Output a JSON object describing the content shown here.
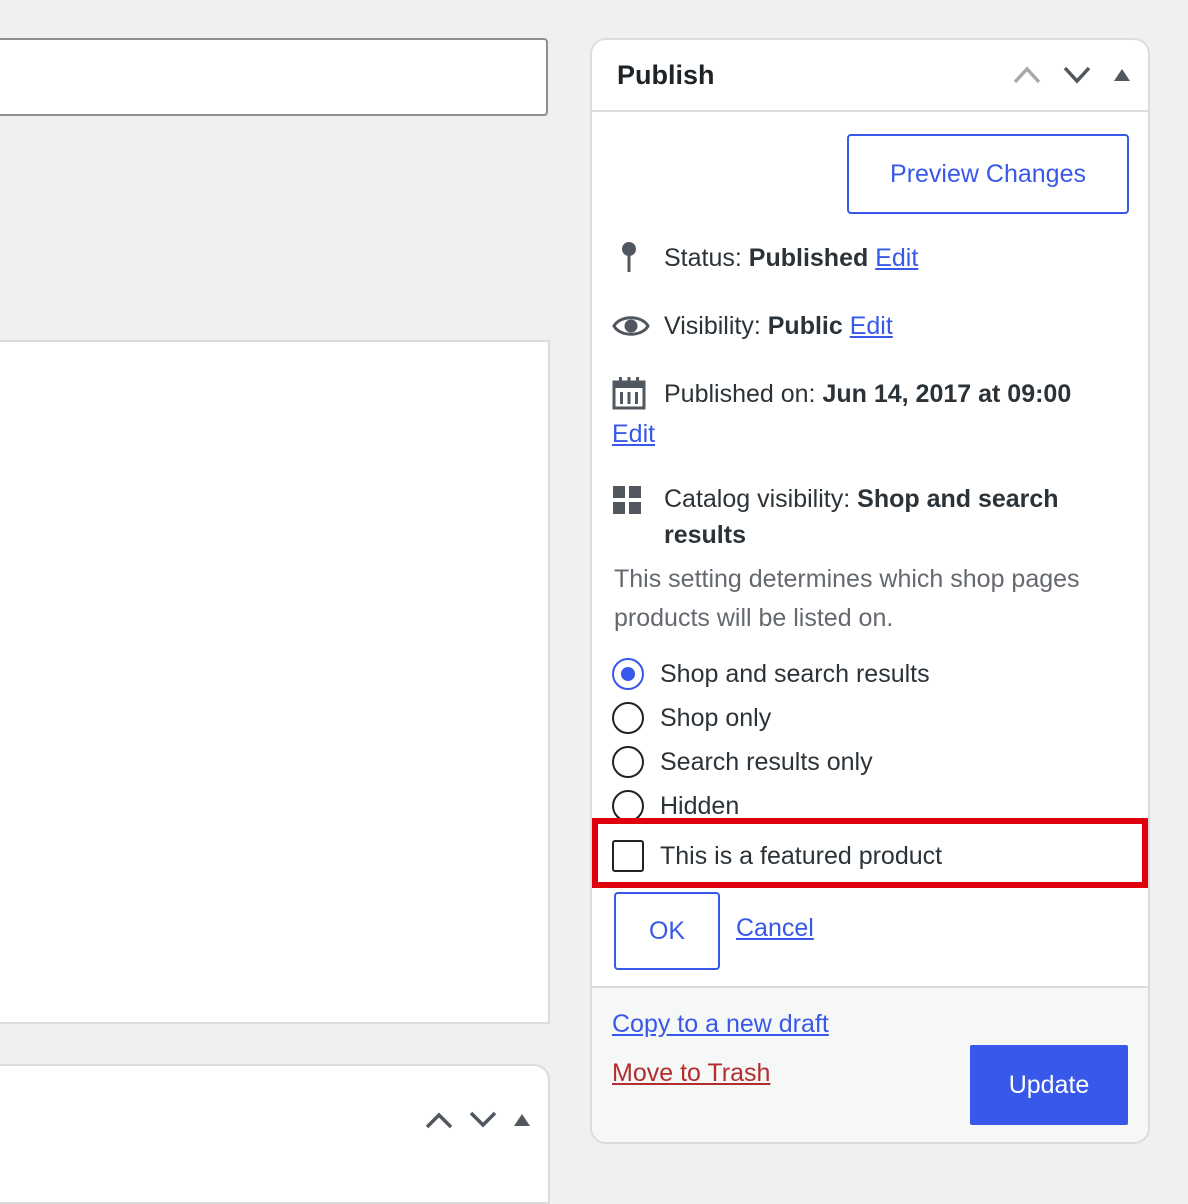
{
  "publish": {
    "title": "Publish",
    "preview_button": "Preview Changes",
    "status": {
      "label": "Status:",
      "value": "Published",
      "edit": "Edit"
    },
    "visibility": {
      "label": "Visibility:",
      "value": "Public",
      "edit": "Edit"
    },
    "published_on": {
      "label": "Published on:",
      "value": "Jun 14, 2017 at 09:00",
      "edit": "Edit"
    },
    "catalog": {
      "label": "Catalog visibility:",
      "value_line1": "Shop and search",
      "value_line2": "results",
      "help_line1": "This setting determines which shop pages",
      "help_line2": "products will be listed on.",
      "options": [
        {
          "label": "Shop and search results",
          "checked": true
        },
        {
          "label": "Shop only",
          "checked": false
        },
        {
          "label": "Search results only",
          "checked": false
        },
        {
          "label": "Hidden",
          "checked": false
        }
      ],
      "featured_label": "This is a featured product",
      "featured_checked": false,
      "ok_button": "OK",
      "cancel_link": "Cancel"
    },
    "copy_link": "Copy to a new draft",
    "trash_link": "Move to Trash",
    "update_button": "Update"
  },
  "colors": {
    "accent": "#3858e9",
    "trash": "#b32d2e",
    "highlight": "#e0000d"
  }
}
